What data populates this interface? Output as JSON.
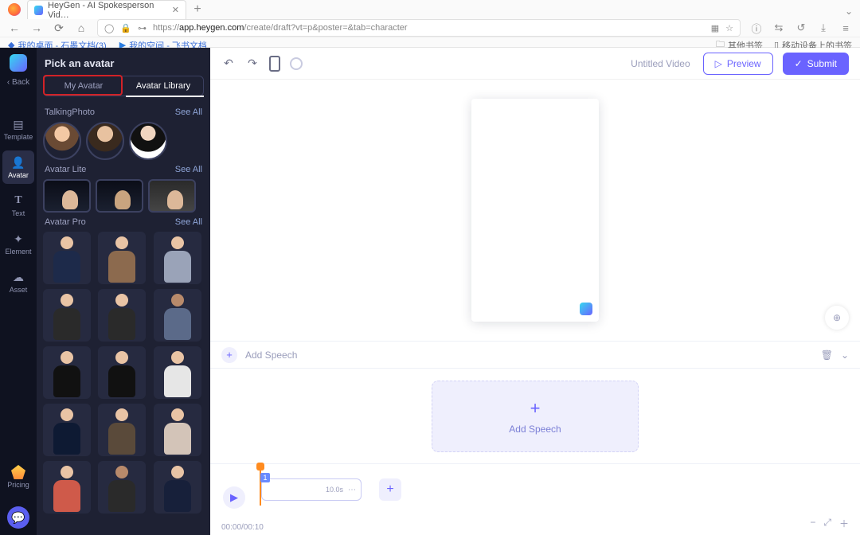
{
  "browser": {
    "tab_title": "HeyGen - AI Spokesperson Vid…",
    "url_prefix": "https://",
    "url_host": "app.heygen.com",
    "url_path": "/create/draft?vt=p&poster=&tab=character",
    "bookmarks": {
      "b1": "我的桌面 - 石墨文档(3)",
      "b2": "我的空间 - 飞书文档",
      "r1": "其他书签",
      "r2": "移动设备上的书签"
    }
  },
  "sidebar": {
    "back": "Back",
    "items": [
      {
        "label": "Template"
      },
      {
        "label": "Avatar"
      },
      {
        "label": "Text"
      },
      {
        "label": "Element"
      },
      {
        "label": "Asset"
      }
    ],
    "pricing": "Pricing"
  },
  "panel": {
    "title": "Pick an avatar",
    "tab_my": "My Avatar",
    "tab_lib": "Avatar Library",
    "sec1": {
      "title": "TalkingPhoto",
      "see": "See All"
    },
    "sec2": {
      "title": "Avatar Lite",
      "see": "See All"
    },
    "sec3": {
      "title": "Avatar Pro",
      "see": "See All"
    }
  },
  "topbar": {
    "title": "Untitled Video",
    "preview": "Preview",
    "submit": "Submit"
  },
  "speech": {
    "add": "Add Speech",
    "big_add": "Add Speech"
  },
  "timeline": {
    "clip_index": "1",
    "clip_dur": "10.0s",
    "time": "00:00/00:10"
  }
}
